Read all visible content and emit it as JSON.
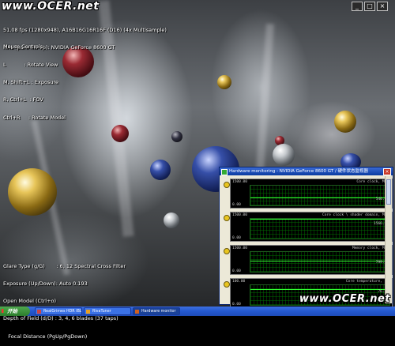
{
  "watermark": {
    "top": "www.OCER.net",
    "bottom": "www.OCER.net"
  },
  "hud": {
    "stats": [
      "51.08 fps (1280x948), A16B16G16R16F (D16) (4x Multisample)",
      "HAL (pure hw vp): NVIDIA GeForce 8600 GT"
    ],
    "controls_title": "Mouse Controls:",
    "controls": [
      "L           : Rotate View",
      "M, Shift+L : Exposure",
      "R, Ctrl+L  : FOV",
      "Ctrl+R     : Rotate Model"
    ],
    "bottom": [
      "Glare Type (g/G)       : 6, 12 Spectral Cross Filter",
      "Exposure (Up/Down): Auto 0.193",
      "Open Model (Ctrl+o)",
      "Depth of Field (d/D) : 3, 4, 6 blades (37 taps)",
      "   Focal Distance (PgUp/PgDown)"
    ]
  },
  "window_controls": {
    "minimize": "_",
    "maximize": "□",
    "close": "×"
  },
  "hw_monitor": {
    "title": "Hardware monitoring - NVIDIA GeForce 8600 GT / 硬件状态监视器",
    "close": "×",
    "graphs": [
      {
        "title": "Core clock, MHz",
        "y_max": "1500.00",
        "y_min": "0.00",
        "value": "540.00",
        "level": 0.36
      },
      {
        "title": "Core clock \\ shader domain, MHz",
        "y_max": "1500.00",
        "y_min": "0.00",
        "value": "1566.00",
        "level": 0.98
      },
      {
        "title": "Memory clock, MHz",
        "y_max": "1500.00",
        "y_min": "0.00",
        "value": "799.20",
        "level": 0.53
      },
      {
        "title": "Core temperature, °C",
        "y_max": "100.00",
        "y_min": "0.00",
        "value": "76.00",
        "level": 0.76
      }
    ]
  },
  "taskbar": {
    "start": "开始",
    "tasks": [
      {
        "label": "RealGrimes HDR IBL",
        "active": false
      },
      {
        "label": "RivaTuner",
        "active": false
      },
      {
        "label": "Hardware monitor",
        "active": true
      }
    ]
  }
}
